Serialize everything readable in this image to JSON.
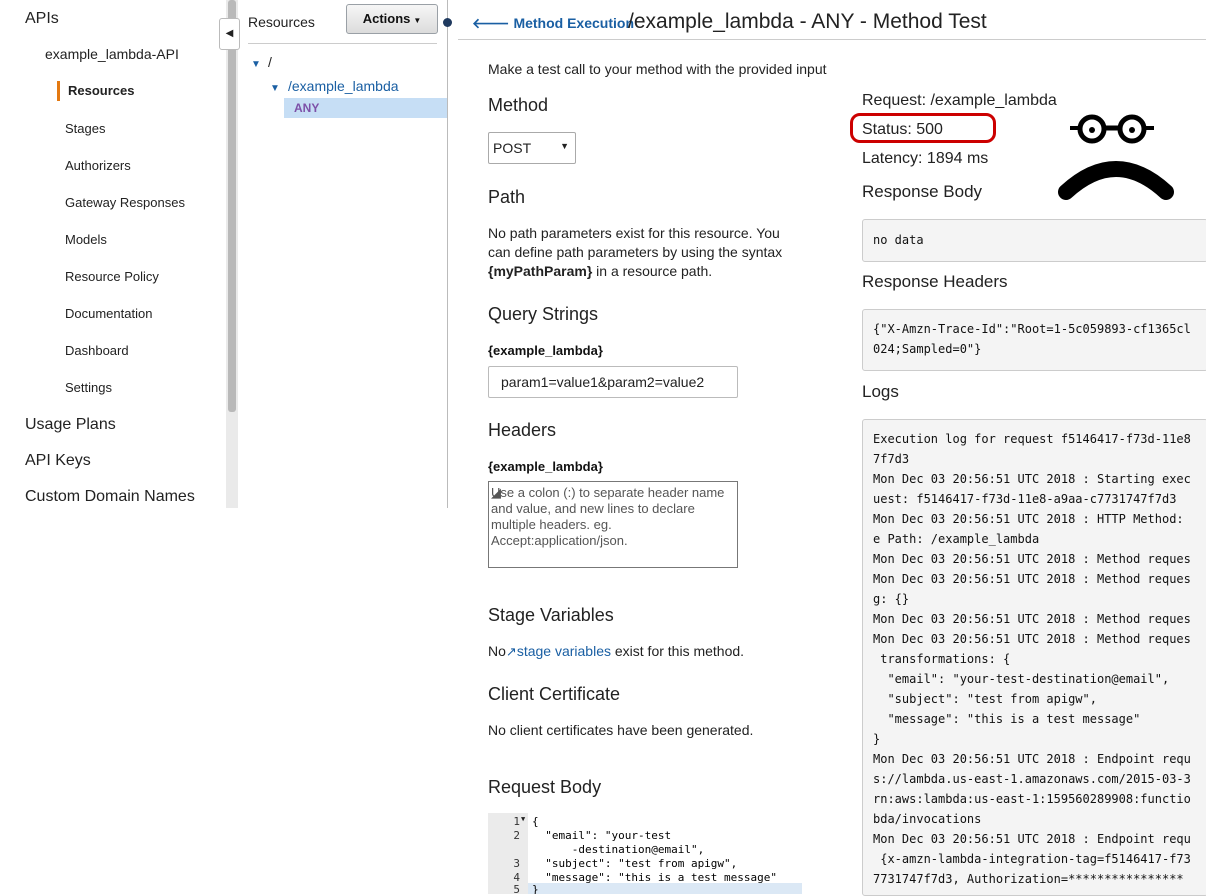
{
  "sidebar": {
    "apis": "APIs",
    "api_name": "example_lambda-API",
    "items": [
      "Resources",
      "Stages",
      "Authorizers",
      "Gateway Responses",
      "Models",
      "Resource Policy",
      "Documentation",
      "Dashboard",
      "Settings"
    ],
    "bottom": [
      "Usage Plans",
      "API Keys",
      "Custom Domain Names"
    ]
  },
  "resources": {
    "title": "Resources",
    "actions": "Actions",
    "tree": [
      "/",
      "/example_lambda",
      "ANY"
    ]
  },
  "header": {
    "back": "Method Execution",
    "title": "/example_lambda - ANY - Method Test"
  },
  "form": {
    "intro": "Make a test call to your method with the provided input",
    "method_heading": "Method",
    "method_value": "POST",
    "path_heading": "Path",
    "path_text": [
      "No path parameters exist for this resource. You",
      "can define path parameters by using the syntax"
    ],
    "path_param": "{myPathParam}",
    "path_suffix": "in a resource path.",
    "qs_heading": "Query Strings",
    "qs_label": "{example_lambda}",
    "qs_value": "param1=value1&param2=value2",
    "headers_heading": "Headers",
    "headers_label": "{example_lambda}",
    "headers_placeholder": "Use a colon (:) to separate header name and value, and new lines to declare multiple headers. eg. Accept:application/json.",
    "stage_heading": "Stage Variables",
    "stage_pre": "No",
    "stage_link": "stage variables",
    "stage_post": "exist for this method.",
    "cert_heading": "Client Certificate",
    "cert_text": "No client certificates have been generated.",
    "body_heading": "Request Body",
    "line_numbers": [
      "1",
      "2",
      "",
      "3",
      "4",
      "5"
    ],
    "code_lines": [
      "{",
      "  \"email\": \"your-test",
      "      -destination@email\",",
      "  \"subject\": \"test from apigw\",",
      "  \"message\": \"this is a test message\"",
      "}"
    ]
  },
  "response": {
    "request": "Request: /example_lambda",
    "status": "Status: 500",
    "latency": "Latency: 1894 ms",
    "body_heading": "Response Body",
    "body": "no data",
    "headers_heading": "Response Headers",
    "headers_lines": [
      "{\"X-Amzn-Trace-Id\":\"Root=1-5c059893-cf1365cl",
      "024;Sampled=0\"}"
    ],
    "logs_heading": "Logs",
    "logs": [
      "Execution log for request f5146417-f73d-11e8",
      "7f7d3",
      "Mon Dec 03 20:56:51 UTC 2018 : Starting exec",
      "uest: f5146417-f73d-11e8-a9aa-c7731747f7d3",
      "Mon Dec 03 20:56:51 UTC 2018 : HTTP Method:",
      "e Path: /example_lambda",
      "Mon Dec 03 20:56:51 UTC 2018 : Method reques",
      "Mon Dec 03 20:56:51 UTC 2018 : Method reques",
      "g: {}",
      "Mon Dec 03 20:56:51 UTC 2018 : Method reques",
      "Mon Dec 03 20:56:51 UTC 2018 : Method reques",
      " transformations: {",
      "  \"email\": \"your-test-destination@email\",",
      "  \"subject\": \"test from apigw\",",
      "  \"message\": \"this is a test message\"",
      "}",
      "Mon Dec 03 20:56:51 UTC 2018 : Endpoint requ",
      "s://lambda.us-east-1.amazonaws.com/2015-03-3",
      "rn:aws:lambda:us-east-1:159560289908:functio",
      "bda/invocations",
      "Mon Dec 03 20:56:51 UTC 2018 : Endpoint requ",
      " {x-amzn-lambda-integration-tag=f5146417-f73",
      "7731747f7d3, Authorization=****************"
    ]
  }
}
